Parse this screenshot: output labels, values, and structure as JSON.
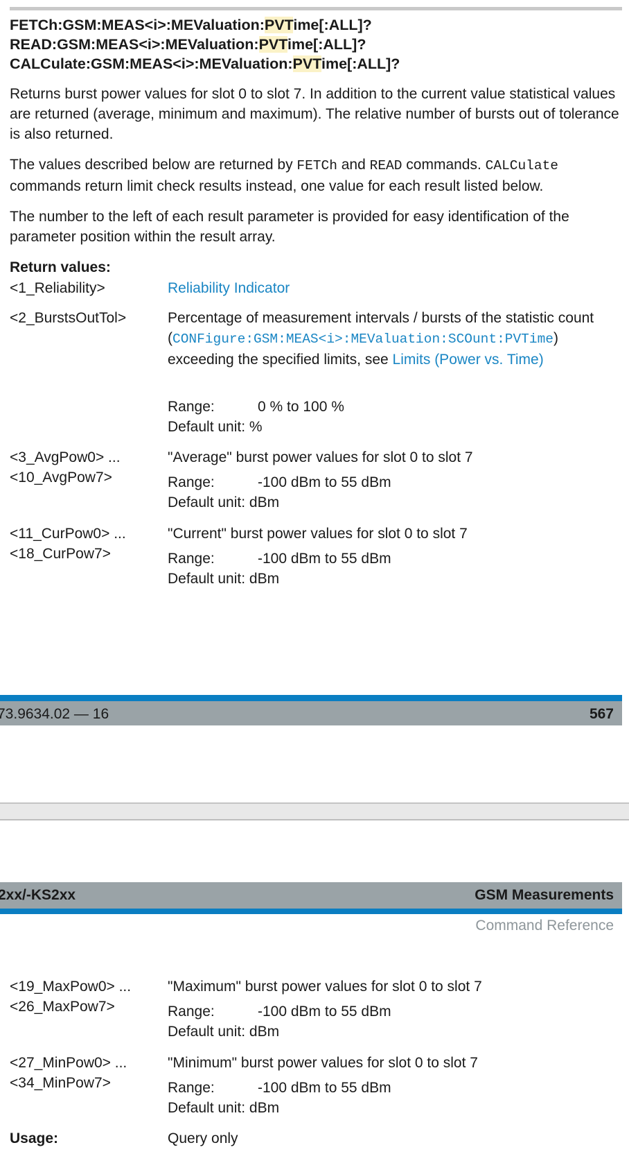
{
  "commands": {
    "fetch": {
      "pre": "FETCh:GSM:MEAS<i>:MEValuation:",
      "hl": "PVT",
      "post": "ime[:ALL]?"
    },
    "read": {
      "pre": "READ:GSM:MEAS<i>:MEValuation:",
      "hl": "PVT",
      "post": "ime[:ALL]?"
    },
    "calc": {
      "pre": "CALCulate:GSM:MEAS<i>:MEValuation:",
      "hl": "PVT",
      "post": "ime[:ALL]?"
    }
  },
  "intro": {
    "p1": "Returns burst power values for slot 0 to slot 7. In addition to the current value statistical values are returned (average, minimum and maximum). The relative number of bursts out of tolerance is also returned.",
    "p2_a": "The values described below are returned by ",
    "p2_fetch": "FETCh",
    "p2_and": " and ",
    "p2_read": "READ",
    "p2_b": " commands. ",
    "p2_calc": "CALCulate",
    "p2_c": " commands return limit check results instead, one value for each result listed below.",
    "p3": "The number to the left of each result parameter is provided for easy identification of the parameter position within the result array."
  },
  "return_values_label": "Return values:",
  "params": {
    "reliability": {
      "name": "<1_Reliability>",
      "link": "Reliability Indicator"
    },
    "bursts": {
      "name": "<2_BurstsOutTol>",
      "desc_a": "Percentage of measurement intervals / bursts of the statistic count (",
      "desc_code": "CONFigure:GSM:MEAS<i>:MEValuation:SCOunt:PVTime",
      "desc_b": ") exceeding the specified limits, see ",
      "desc_link": "Limits (Power vs. Time)",
      "range_label": "Range:",
      "range_value": "0 %  to  100 %",
      "unit_label": "Default unit:",
      "unit_value": "%"
    },
    "avg": {
      "name1": "<3_AvgPow0> ...",
      "name2": "<10_AvgPow7>",
      "desc": "\"Average\" burst power values for slot 0 to slot 7",
      "range_label": "Range:",
      "range_value": "-100 dBm  to  55 dBm",
      "unit_label": "Default unit:",
      "unit_value": "dBm"
    },
    "cur": {
      "name1": "<11_CurPow0> ...",
      "name2": "<18_CurPow7>",
      "desc": "\"Current\" burst power values for slot 0 to slot 7",
      "range_label": "Range:",
      "range_value": "-100 dBm  to  55 dBm",
      "unit_label": "Default unit:",
      "unit_value": "dBm"
    },
    "max": {
      "name1": "<19_MaxPow0> ...",
      "name2": "<26_MaxPow7>",
      "desc": "\"Maximum\" burst power values for slot 0 to slot 7",
      "range_label": "Range:",
      "range_value": "-100 dBm  to  55 dBm",
      "unit_label": "Default unit:",
      "unit_value": "dBm"
    },
    "min": {
      "name1": "<27_MinPow0> ...",
      "name2": "<34_MinPow7>",
      "desc": "\"Minimum\" burst power values for slot 0 to slot 7",
      "range_label": "Range:",
      "range_value": "-100 dBm  to  55 dBm",
      "unit_label": "Default unit:",
      "unit_value": "dBm"
    }
  },
  "usage": {
    "label": "Usage:",
    "value": "Query only"
  },
  "footer": {
    "doc_id": "73.9634.02 — 16",
    "page": "567"
  },
  "header": {
    "product": "2xx/-KS2xx",
    "chapter": "GSM Measurements",
    "section": "Command Reference"
  }
}
